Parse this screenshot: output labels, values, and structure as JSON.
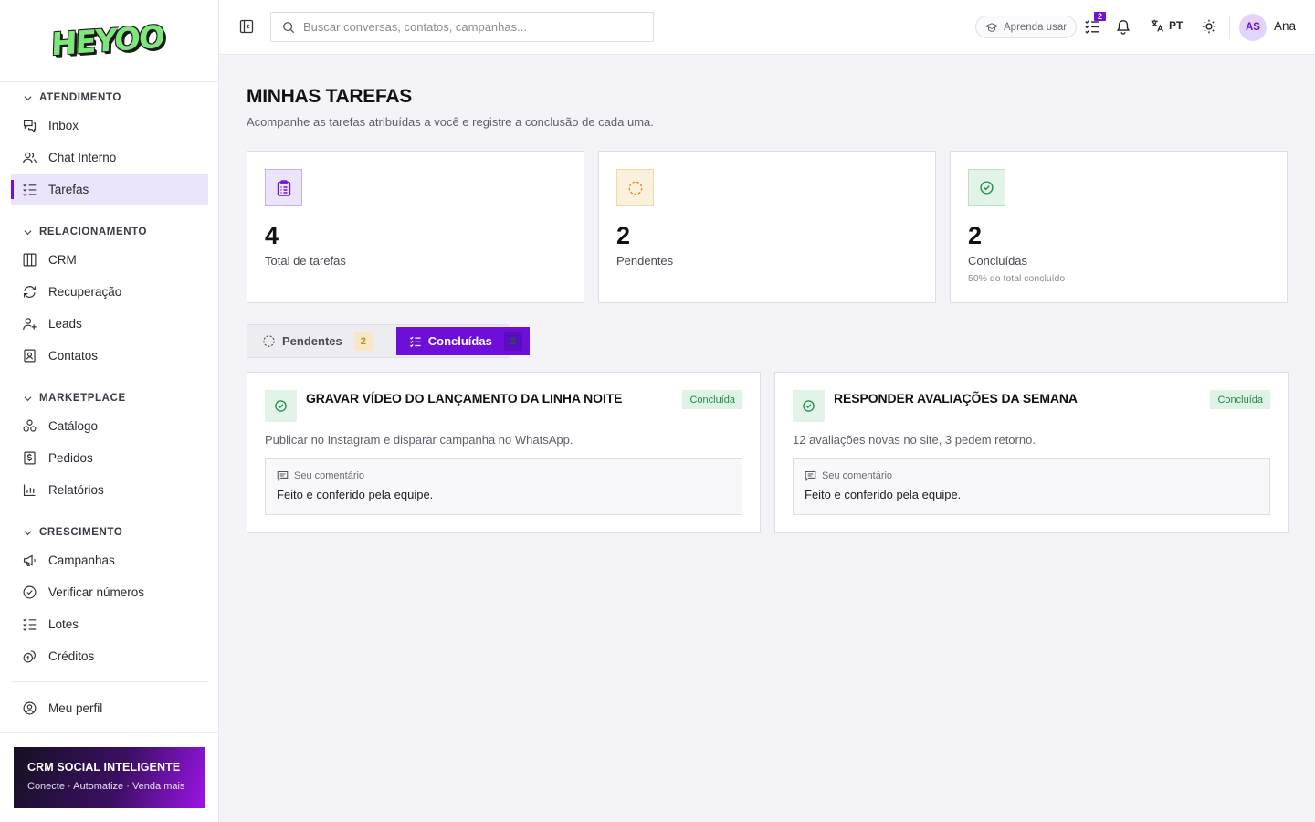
{
  "brand": {
    "logo_text": "HEYOO"
  },
  "colors": {
    "accent": "#6d12d6",
    "success": "#22894c",
    "warning": "#c88a1a"
  },
  "sidebar": {
    "sections": [
      {
        "title": "ATENDIMENTO",
        "items": [
          {
            "label": "Inbox",
            "icon": "inbox-icon"
          },
          {
            "label": "Chat Interno",
            "icon": "users-icon"
          },
          {
            "label": "Tarefas",
            "icon": "tasks-icon",
            "active": true
          }
        ]
      },
      {
        "title": "RELACIONAMENTO",
        "items": [
          {
            "label": "CRM",
            "icon": "kanban-icon"
          },
          {
            "label": "Recuperação",
            "icon": "refresh-icon"
          },
          {
            "label": "Leads",
            "icon": "user-plus-icon"
          },
          {
            "label": "Contatos",
            "icon": "contact-icon"
          }
        ]
      },
      {
        "title": "MARKETPLACE",
        "items": [
          {
            "label": "Catálogo",
            "icon": "catalog-icon"
          },
          {
            "label": "Pedidos",
            "icon": "orders-icon"
          },
          {
            "label": "Relatórios",
            "icon": "chart-icon"
          }
        ]
      },
      {
        "title": "CRESCIMENTO",
        "items": [
          {
            "label": "Campanhas",
            "icon": "megaphone-icon"
          },
          {
            "label": "Verificar números",
            "icon": "check-circle-icon"
          },
          {
            "label": "Lotes",
            "icon": "list-check-icon"
          },
          {
            "label": "Créditos",
            "icon": "coins-icon"
          }
        ]
      }
    ],
    "profile_label": "Meu perfil",
    "promo": {
      "title": "CRM SOCIAL INTELIGENTE",
      "subtitle": "Conecte · Automatize · Venda mais"
    }
  },
  "topbar": {
    "search_placeholder": "Buscar conversas, contatos, campanhas...",
    "learn_label": "Aprenda usar",
    "tasks_badge": "2",
    "language": "PT",
    "avatar_initials": "AS",
    "username": "Ana"
  },
  "page": {
    "title": "MINHAS TAREFAS",
    "subtitle": "Acompanhe as tarefas atribuídas a você e registre a conclusão de cada uma."
  },
  "stats": [
    {
      "value": "4",
      "label": "Total de tarefas",
      "hint": ""
    },
    {
      "value": "2",
      "label": "Pendentes",
      "hint": ""
    },
    {
      "value": "2",
      "label": "Concluídas",
      "hint": "50% do total concluído"
    }
  ],
  "tabs": [
    {
      "label": "Pendentes",
      "count": "2"
    },
    {
      "label": "Concluídas",
      "count": "2"
    }
  ],
  "tasks": [
    {
      "title": "GRAVAR VÍDEO DO LANÇAMENTO DA LINHA NOITE",
      "status": "Concluída",
      "description": "Publicar no Instagram e disparar campanha no WhatsApp.",
      "comment_label": "Seu comentário",
      "comment": "Feito e conferido pela equipe."
    },
    {
      "title": "RESPONDER AVALIAÇÕES DA SEMANA",
      "status": "Concluída",
      "description": "12 avaliações novas no site, 3 pedem retorno.",
      "comment_label": "Seu comentário",
      "comment": "Feito e conferido pela equipe."
    }
  ]
}
